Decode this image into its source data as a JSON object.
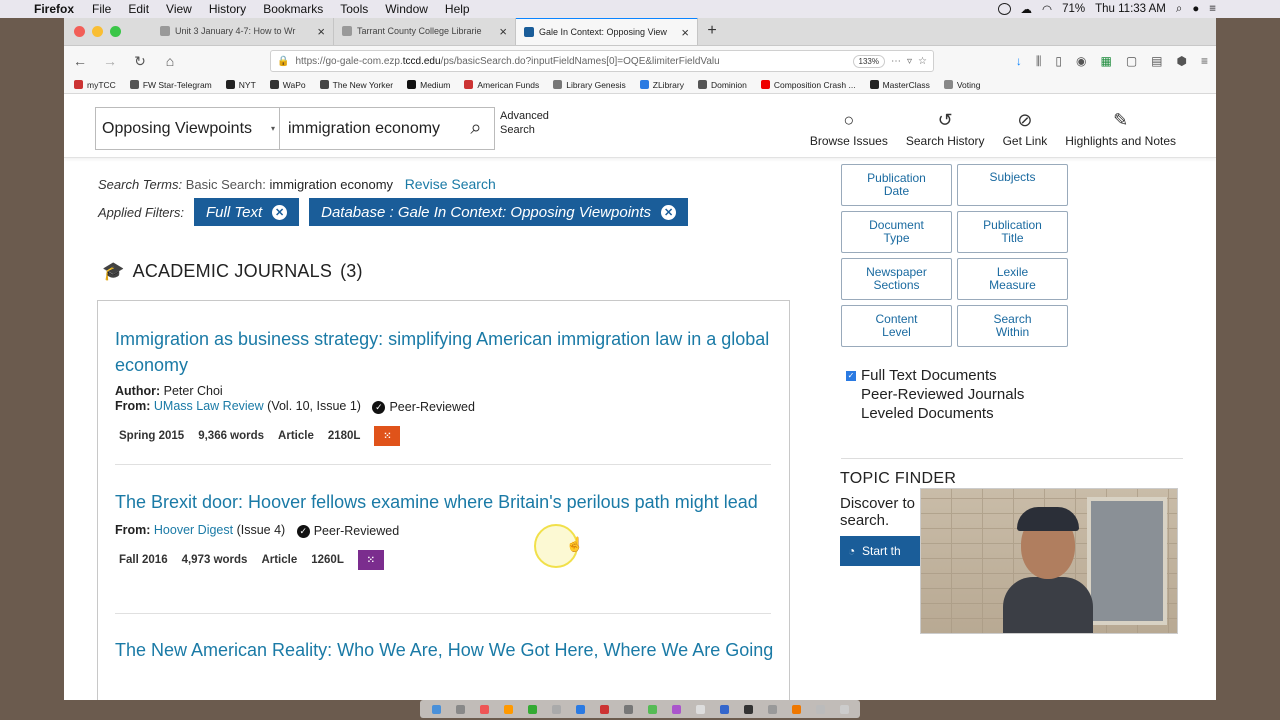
{
  "menubar": {
    "app_name": "Firefox",
    "items": [
      "File",
      "Edit",
      "View",
      "History",
      "Bookmarks",
      "Tools",
      "Window",
      "Help"
    ],
    "battery": "71%",
    "clock": "Thu 11:33 AM"
  },
  "tabs": [
    {
      "title": "Unit 3 January 4-7: How to Wr",
      "active": false
    },
    {
      "title": "Tarrant County College Librarie",
      "active": false
    },
    {
      "title": "Gale In Context: Opposing View",
      "active": true
    }
  ],
  "urlbar": {
    "url_prefix": "https://go-gale-com.ezp.",
    "url_domain": "tccd.edu",
    "url_suffix": "/ps/basicSearch.do?inputFieldNames[0]=OQE&limiterFieldValu",
    "zoom": "133%"
  },
  "bookmarks": [
    "myTCC",
    "FW Star-Telegram",
    "NYT",
    "WaPo",
    "The New Yorker",
    "Medium",
    "American Funds",
    "Library Genesis",
    "ZLibrary",
    "Dominion",
    "Composition Crash ...",
    "MasterClass",
    "Voting"
  ],
  "search": {
    "database": "Opposing Viewpoints",
    "query": "immigration economy",
    "advanced_line1": "Advanced",
    "advanced_line2": "Search"
  },
  "tools": [
    {
      "label": "Browse Issues",
      "icon": "lightbulb-icon",
      "glyph": "💡"
    },
    {
      "label": "Search History",
      "icon": "history-icon",
      "glyph": "⟲"
    },
    {
      "label": "Get Link",
      "icon": "link-icon",
      "glyph": "🔗"
    },
    {
      "label": "Highlights and Notes",
      "icon": "pen-icon",
      "glyph": "✎"
    }
  ],
  "search_terms": {
    "label": "Search Terms:",
    "type": "Basic Search:",
    "value": "immigration economy",
    "revise": "Revise Search"
  },
  "filters": {
    "label": "Applied Filters:",
    "chips": [
      {
        "text": "Full Text"
      },
      {
        "text": "Database : Gale In Context: Opposing Viewpoints"
      }
    ]
  },
  "section": {
    "title": "ACADEMIC JOURNALS",
    "count": "(3)"
  },
  "results": [
    {
      "title": "Immigration as business strategy: simplifying American immigration law in a global economy",
      "author_label": "Author:",
      "author": "Peter Choi",
      "from_label": "From:",
      "source": "UMass Law Review",
      "issue": "(Vol. 10, Issue 1)",
      "peer": "Peer-Reviewed",
      "date": "Spring 2015",
      "words": "9,366 words",
      "doctype": "Article",
      "lexile": "2180L",
      "lexile_color": "#e0531a"
    },
    {
      "title": "The Brexit door: Hoover fellows examine where Britain's perilous path might lead",
      "from_label": "From:",
      "source": "Hoover Digest",
      "issue": "(Issue 4)",
      "peer": "Peer-Reviewed",
      "date": "Fall 2016",
      "words": "4,973 words",
      "doctype": "Article",
      "lexile": "1260L",
      "lexile_color": "#7b2d8e"
    },
    {
      "title": "The New American Reality: Who We Are, How We Got Here, Where We Are Going"
    }
  ],
  "facets": [
    {
      "line1": "Publication",
      "line2": "Date"
    },
    {
      "line1": "Subjects",
      "line2": ""
    },
    {
      "line1": "Document",
      "line2": "Type"
    },
    {
      "line1": "Publication",
      "line2": "Title"
    },
    {
      "line1": "Newspaper",
      "line2": "Sections"
    },
    {
      "line1": "Lexile",
      "line2": "Measure"
    },
    {
      "line1": "Content",
      "line2": "Level"
    },
    {
      "line1": "Search",
      "line2": "Within"
    }
  ],
  "limiters": [
    {
      "label": "Full Text Documents",
      "checked": true
    },
    {
      "label": "Peer-Reviewed Journals",
      "checked": false
    },
    {
      "label": "Leveled Documents",
      "checked": false
    }
  ],
  "topic_finder": {
    "title": "TOPIC FINDER",
    "desc_line1": "Discover to",
    "desc_line2": "search.",
    "button": "Start th"
  }
}
